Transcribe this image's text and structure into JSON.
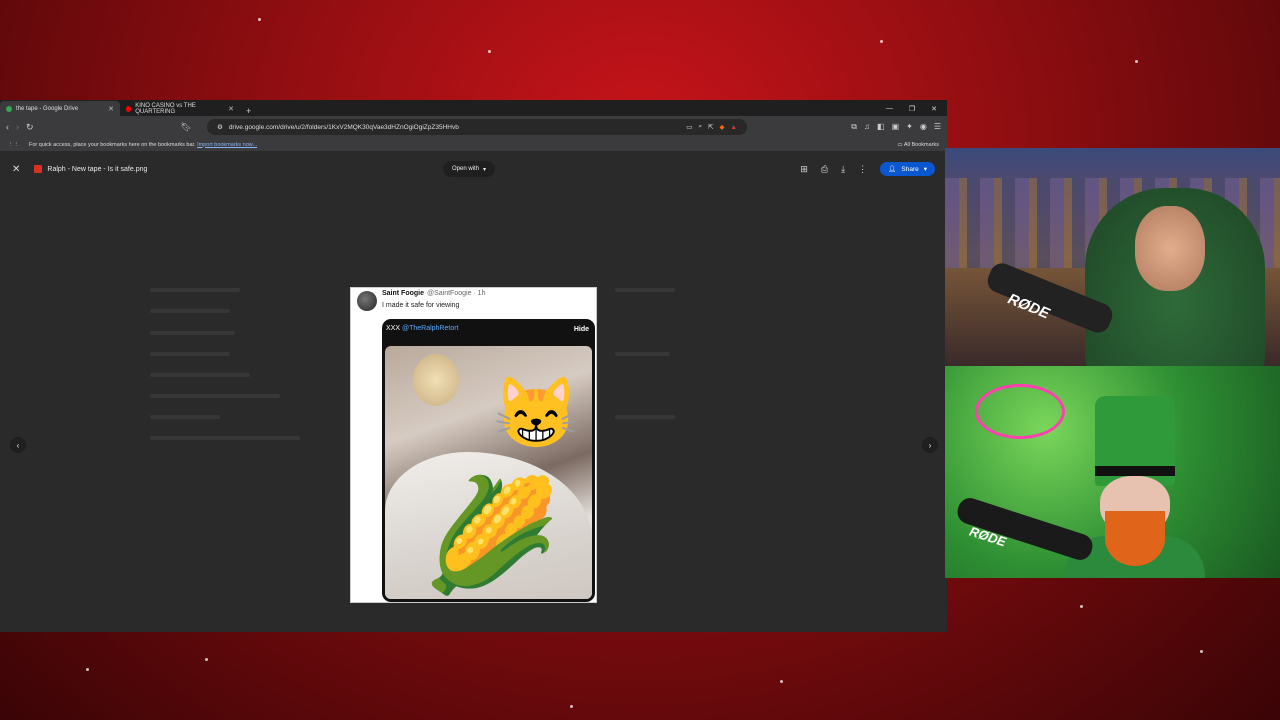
{
  "browser": {
    "tabs": [
      {
        "title": "the tape - Google Drive",
        "active": true,
        "favicon_color": "#34a853"
      },
      {
        "title": "KINO CASINO vs THE QUARTERING",
        "active": false,
        "favicon_color": "#ff0000"
      }
    ],
    "new_tab_icon": "plus-icon",
    "url": "drive.google.com/drive/u/2/folders/1KxV2MQK30qVae3dHZnOgiOgiZpZ35HHvb",
    "bookmarks_bar": {
      "message": "For quick access, place your bookmarks here on the bookmarks bar.",
      "import_link": "Import bookmarks now...",
      "all_bookmarks": "All Bookmarks"
    }
  },
  "viewer": {
    "file_name": "Ralph - New tape - Is it safe.png",
    "open_with": "Open with",
    "share": "Share",
    "accent": "#0b57d0"
  },
  "tweet": {
    "name": "Saint Foogie",
    "handle": "@SaintFoogie · 1h",
    "text": "I made it safe for viewing",
    "media_label": "XXX",
    "media_link": "@TheRalphRetort",
    "hide": "Hide"
  },
  "webcams": {
    "cam1_mic_brand": "RØDE",
    "cam2_mic_brand": "RØDE"
  }
}
